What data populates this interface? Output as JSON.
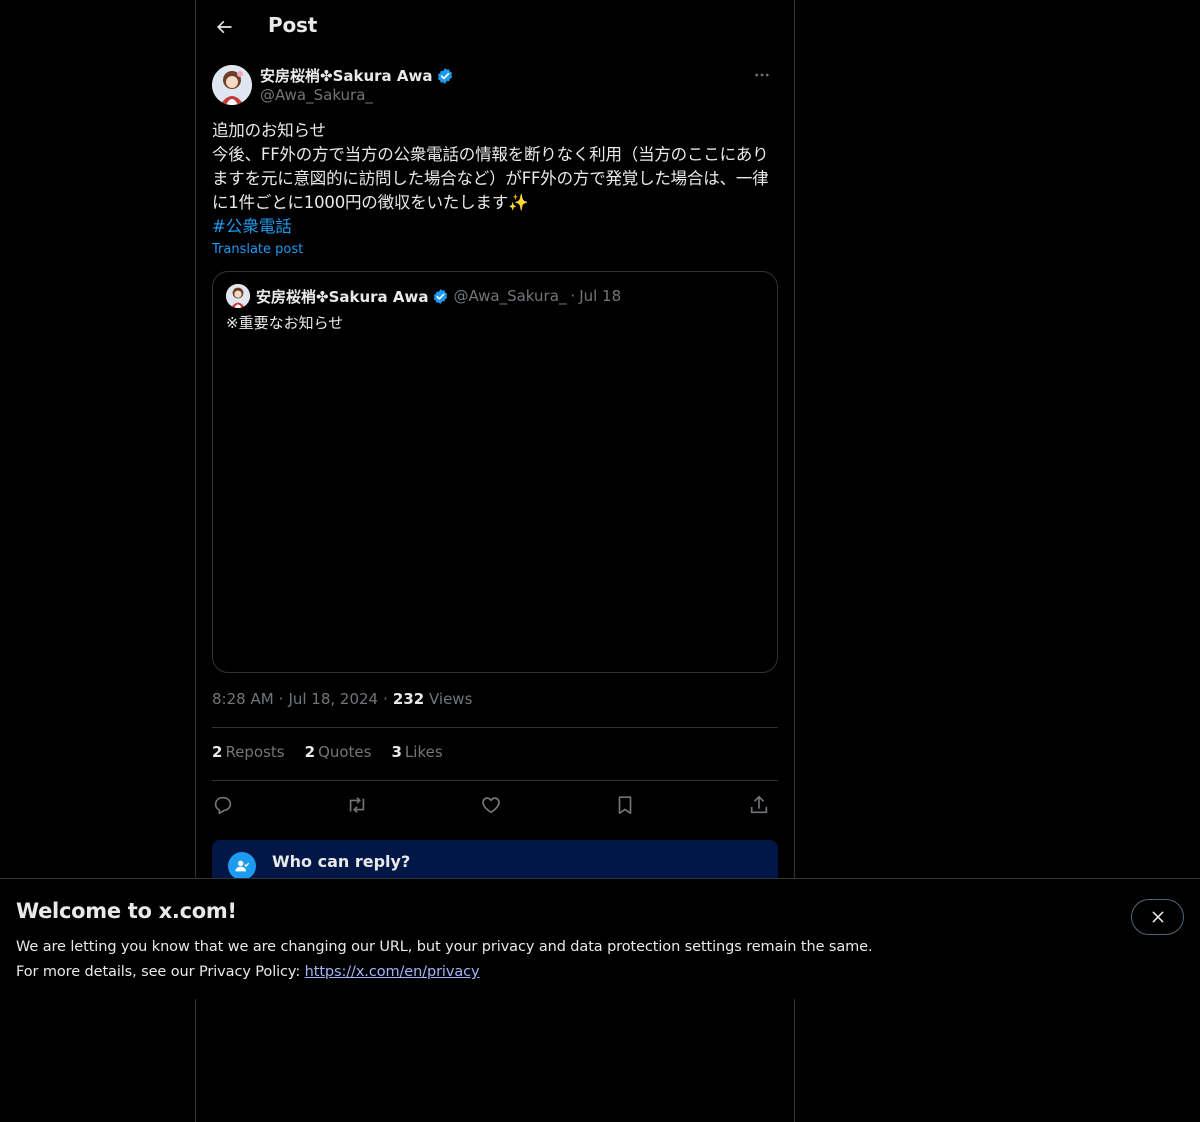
{
  "header": {
    "title": "Post",
    "back_icon": "arrow-left-icon"
  },
  "author": {
    "name": "安房桜梢✤Sakura Awa",
    "handle": "@Awa_Sakura_",
    "verified": true,
    "more_icon": "more-horizontal-icon"
  },
  "post": {
    "text": "追加のお知らせ\n今後、FF外の方で当方の公衆電話の情報を断りなく利用（当方のここにありますを元に意図的に訪問した場合など）がFF外の方で発覚した場合は、一律に1件ごとに1000円の徴収をいたします✨",
    "hashtag": "#公衆電話",
    "translate_label": "Translate post"
  },
  "quote": {
    "name": "安房桜梢✤Sakura Awa",
    "handle": "@Awa_Sakura_",
    "separator": "·",
    "date": "Jul 18",
    "text": "※重要なお知らせ"
  },
  "meta": {
    "time": "8:28 AM",
    "separator": "·",
    "date": "Jul 18, 2024",
    "views_count": "232",
    "views_label": "Views"
  },
  "stats": {
    "reposts_count": "2",
    "reposts_label": "Reposts",
    "quotes_count": "2",
    "quotes_label": "Quotes",
    "likes_count": "3",
    "likes_label": "Likes"
  },
  "actions": [
    "reply-icon",
    "repost-icon",
    "like-icon",
    "bookmark-icon",
    "share-icon"
  ],
  "reply_restriction": {
    "title": "Who can reply?"
  },
  "banner": {
    "title": "Welcome to x.com!",
    "line1": "We are letting you know that we are changing our URL, but your privacy and data protection settings remain the same.",
    "line2_prefix": "For more details, see our Privacy Policy: ",
    "link": "https://x.com/en/privacy",
    "close_icon": "close-icon"
  },
  "colors": {
    "background": "#000000",
    "text": "#e7e9ea",
    "muted": "#71767b",
    "accent": "#1d9bf0",
    "border": "#2f3336",
    "reply_box": "#031746"
  }
}
